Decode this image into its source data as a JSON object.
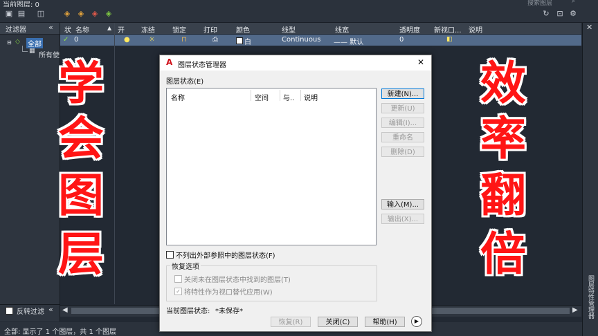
{
  "window": {
    "current_layer_label": "当前图层: 0",
    "search_placeholder": "搜索图层"
  },
  "filters": {
    "title": "过滤器",
    "collapse": "«",
    "tree": [
      {
        "label": "全部"
      },
      {
        "label": "所有使"
      }
    ],
    "reverse_filter_label": "反转过滤",
    "collapse2": "«"
  },
  "grid": {
    "columns": [
      "状",
      "名称",
      "开",
      "冻结",
      "锁定",
      "打印",
      "颜色",
      "线型",
      "线宽",
      "透明度",
      "新视口...",
      "说明"
    ],
    "rows": [
      {
        "status": "✓",
        "name": "0",
        "color": "白",
        "linetype": "Continuous",
        "lineweight": "—— 默认",
        "transparency": "0"
      }
    ]
  },
  "status_bar": {
    "text": "全部: 显示了 1 个图层，共 1 个图层"
  },
  "right_strip": {
    "vertical_label": "图层特性管理器"
  },
  "overlay": {
    "left_chars": [
      "学",
      "会",
      "图",
      "层"
    ],
    "right_chars": [
      "效",
      "率",
      "翻",
      "倍"
    ]
  },
  "dialog": {
    "title": "图层状态管理器",
    "close": "✕",
    "layer_states_label": "图层状态(E)",
    "list_columns": [
      "名称",
      "空间",
      "与..",
      "说明"
    ],
    "side_buttons": [
      {
        "label": "新建(N)...",
        "enabled": true
      },
      {
        "label": "更新(U)",
        "enabled": false
      },
      {
        "label": "编辑(I)...",
        "enabled": false
      },
      {
        "label": "重命名",
        "enabled": false
      },
      {
        "label": "删除(D)",
        "enabled": false
      },
      {
        "label": "输入(M)...",
        "enabled": true
      },
      {
        "label": "输出(X)...",
        "enabled": false
      }
    ],
    "exclude_xref_label": "不列出外部参照中的图层状态(F)",
    "restore_options_title": "恢复选项",
    "restore_options": [
      {
        "label": "关闭未在图层状态中找到的图层(T)",
        "checked": false
      },
      {
        "label": "将特性作为视口替代应用(W)",
        "checked": true
      }
    ],
    "current_state_label": "当前图层状态:",
    "current_state_value": "*未保存*",
    "bottom_buttons": [
      "恢复(R)",
      "关闭(C)",
      "帮助(H)"
    ]
  },
  "colors": {
    "accent_red": "#ff1515",
    "row_highlight": "#526a8a"
  }
}
